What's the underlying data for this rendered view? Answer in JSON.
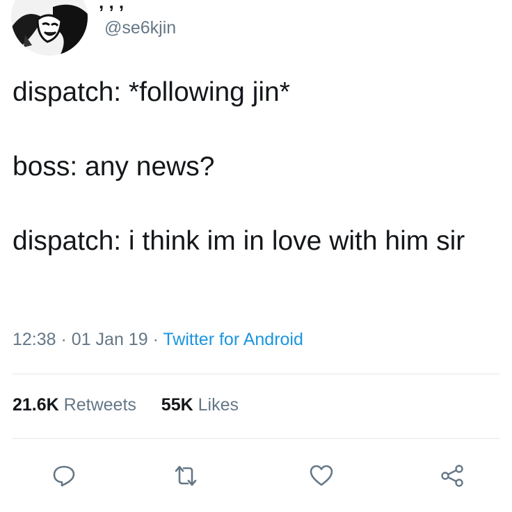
{
  "author": {
    "display_name": ", , ,",
    "handle": "@se6kjin"
  },
  "tweet": {
    "lines": [
      "dispatch: *following jin*",
      "boss: any news?",
      "dispatch: i think im in love with him sir"
    ]
  },
  "meta": {
    "time": "12:38",
    "date": "01 Jan 19",
    "separator": "·",
    "source": "Twitter for Android"
  },
  "stats": {
    "retweets_count": "21.6K",
    "retweets_label": "Retweets",
    "likes_count": "55K",
    "likes_label": "Likes"
  },
  "actions": {
    "reply_icon": "reply-icon",
    "retweet_icon": "retweet-icon",
    "like_icon": "heart-icon",
    "share_icon": "share-icon"
  },
  "colors": {
    "text": "#14171a",
    "secondary": "#657786",
    "link": "#1b95e0",
    "divider": "#e1e8ed"
  }
}
